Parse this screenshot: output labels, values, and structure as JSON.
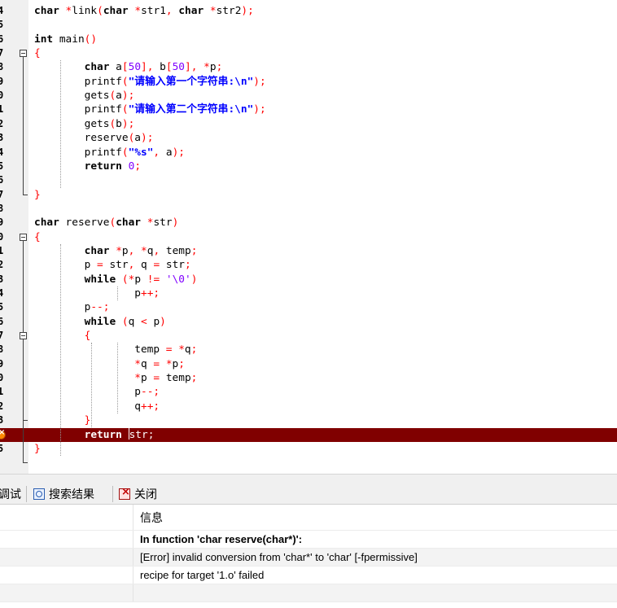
{
  "editor": {
    "lines": [
      {
        "num": "4",
        "tokens": [
          [
            "kw",
            "char"
          ],
          [
            "plain",
            " "
          ],
          [
            "sym",
            "*"
          ],
          [
            "plain",
            "link"
          ],
          [
            "sym",
            "("
          ],
          [
            "kw",
            "char"
          ],
          [
            "plain",
            " "
          ],
          [
            "sym",
            "*"
          ],
          [
            "plain",
            "str1"
          ],
          [
            "sym",
            ", "
          ],
          [
            "kw",
            "char"
          ],
          [
            "plain",
            " "
          ],
          [
            "sym",
            "*"
          ],
          [
            "plain",
            "str2"
          ],
          [
            "sym",
            ");"
          ]
        ]
      },
      {
        "num": "5",
        "tokens": []
      },
      {
        "num": "6",
        "tokens": [
          [
            "kw",
            "int"
          ],
          [
            "plain",
            " main"
          ],
          [
            "sym",
            "()"
          ]
        ]
      },
      {
        "num": "7",
        "tokens": [
          [
            "sym",
            "{"
          ]
        ]
      },
      {
        "num": "8",
        "tokens": [
          [
            "plain",
            "        "
          ],
          [
            "kw",
            "char"
          ],
          [
            "plain",
            " a"
          ],
          [
            "sym",
            "["
          ],
          [
            "num",
            "50"
          ],
          [
            "sym",
            "], "
          ],
          [
            "plain",
            "b"
          ],
          [
            "sym",
            "["
          ],
          [
            "num",
            "50"
          ],
          [
            "sym",
            "], *"
          ],
          [
            "plain",
            "p"
          ],
          [
            "sym",
            ";"
          ]
        ]
      },
      {
        "num": "9",
        "tokens": [
          [
            "plain",
            "        printf"
          ],
          [
            "sym",
            "("
          ],
          [
            "str",
            "\"请输入第一个字符串:\\n\""
          ],
          [
            "sym",
            ");"
          ]
        ]
      },
      {
        "num": "0",
        "tokens": [
          [
            "plain",
            "        gets"
          ],
          [
            "sym",
            "("
          ],
          [
            "plain",
            "a"
          ],
          [
            "sym",
            ");"
          ]
        ]
      },
      {
        "num": "1",
        "tokens": [
          [
            "plain",
            "        printf"
          ],
          [
            "sym",
            "("
          ],
          [
            "str",
            "\"请输入第二个字符串:\\n\""
          ],
          [
            "sym",
            ");"
          ]
        ]
      },
      {
        "num": "2",
        "tokens": [
          [
            "plain",
            "        gets"
          ],
          [
            "sym",
            "("
          ],
          [
            "plain",
            "b"
          ],
          [
            "sym",
            ");"
          ]
        ]
      },
      {
        "num": "3",
        "tokens": [
          [
            "plain",
            "        reserve"
          ],
          [
            "sym",
            "("
          ],
          [
            "plain",
            "a"
          ],
          [
            "sym",
            ");"
          ]
        ]
      },
      {
        "num": "4",
        "tokens": [
          [
            "plain",
            "        printf"
          ],
          [
            "sym",
            "("
          ],
          [
            "str",
            "\"%s\""
          ],
          [
            "sym",
            ", "
          ],
          [
            "plain",
            "a"
          ],
          [
            "sym",
            ");"
          ]
        ]
      },
      {
        "num": "5",
        "tokens": [
          [
            "plain",
            "        "
          ],
          [
            "kw",
            "return"
          ],
          [
            "plain",
            " "
          ],
          [
            "num",
            "0"
          ],
          [
            "sym",
            ";"
          ]
        ]
      },
      {
        "num": "6",
        "tokens": []
      },
      {
        "num": "7",
        "tokens": [
          [
            "sym",
            "}"
          ]
        ]
      },
      {
        "num": "8",
        "tokens": []
      },
      {
        "num": "9",
        "tokens": [
          [
            "kw",
            "char"
          ],
          [
            "plain",
            " reserve"
          ],
          [
            "sym",
            "("
          ],
          [
            "kw",
            "char"
          ],
          [
            "plain",
            " "
          ],
          [
            "sym",
            "*"
          ],
          [
            "plain",
            "str"
          ],
          [
            "sym",
            ")"
          ]
        ]
      },
      {
        "num": "0",
        "tokens": [
          [
            "sym",
            "{"
          ]
        ]
      },
      {
        "num": "1",
        "tokens": [
          [
            "plain",
            "        "
          ],
          [
            "kw",
            "char"
          ],
          [
            "plain",
            " "
          ],
          [
            "sym",
            "*"
          ],
          [
            "plain",
            "p"
          ],
          [
            "sym",
            ", *"
          ],
          [
            "plain",
            "q"
          ],
          [
            "sym",
            ", "
          ],
          [
            "plain",
            "temp"
          ],
          [
            "sym",
            ";"
          ]
        ]
      },
      {
        "num": "2",
        "tokens": [
          [
            "plain",
            "        p "
          ],
          [
            "sym",
            "="
          ],
          [
            "plain",
            " str"
          ],
          [
            "sym",
            ", "
          ],
          [
            "plain",
            "q "
          ],
          [
            "sym",
            "="
          ],
          [
            "plain",
            " str"
          ],
          [
            "sym",
            ";"
          ]
        ]
      },
      {
        "num": "3",
        "tokens": [
          [
            "plain",
            "        "
          ],
          [
            "kw",
            "while"
          ],
          [
            "plain",
            " "
          ],
          [
            "sym",
            "(*"
          ],
          [
            "plain",
            "p "
          ],
          [
            "sym",
            "!="
          ],
          [
            "plain",
            " "
          ],
          [
            "num",
            "'\\0'"
          ],
          [
            "sym",
            ")"
          ]
        ]
      },
      {
        "num": "4",
        "tokens": [
          [
            "plain",
            "                p"
          ],
          [
            "sym",
            "++;"
          ]
        ]
      },
      {
        "num": "5",
        "tokens": [
          [
            "plain",
            "        p"
          ],
          [
            "sym",
            "--;"
          ]
        ]
      },
      {
        "num": "6",
        "tokens": [
          [
            "plain",
            "        "
          ],
          [
            "kw",
            "while"
          ],
          [
            "plain",
            " "
          ],
          [
            "sym",
            "("
          ],
          [
            "plain",
            "q "
          ],
          [
            "sym",
            "<"
          ],
          [
            "plain",
            " p"
          ],
          [
            "sym",
            ")"
          ]
        ]
      },
      {
        "num": "7",
        "tokens": [
          [
            "plain",
            "        "
          ],
          [
            "sym",
            "{"
          ]
        ]
      },
      {
        "num": "8",
        "tokens": [
          [
            "plain",
            "                temp "
          ],
          [
            "sym",
            "= *"
          ],
          [
            "plain",
            "q"
          ],
          [
            "sym",
            ";"
          ]
        ]
      },
      {
        "num": "9",
        "tokens": [
          [
            "plain",
            "                "
          ],
          [
            "sym",
            "*"
          ],
          [
            "plain",
            "q "
          ],
          [
            "sym",
            "= *"
          ],
          [
            "plain",
            "p"
          ],
          [
            "sym",
            ";"
          ]
        ]
      },
      {
        "num": "0",
        "tokens": [
          [
            "plain",
            "                "
          ],
          [
            "sym",
            "*"
          ],
          [
            "plain",
            "p "
          ],
          [
            "sym",
            "="
          ],
          [
            "plain",
            " temp"
          ],
          [
            "sym",
            ";"
          ]
        ]
      },
      {
        "num": "1",
        "tokens": [
          [
            "plain",
            "                p"
          ],
          [
            "sym",
            "--;"
          ]
        ]
      },
      {
        "num": "2",
        "tokens": [
          [
            "plain",
            "                q"
          ],
          [
            "sym",
            "++;"
          ]
        ]
      },
      {
        "num": "3",
        "tokens": [
          [
            "plain",
            "        "
          ],
          [
            "sym",
            "}"
          ]
        ]
      },
      {
        "num": "",
        "tokens": [
          [
            "plain",
            "        "
          ],
          [
            "kw",
            "return"
          ],
          [
            "plain",
            " "
          ],
          [
            "caret",
            ""
          ],
          [
            "plain",
            "str"
          ],
          [
            "sym",
            ";"
          ]
        ]
      },
      {
        "num": "5",
        "tokens": [
          [
            "sym",
            "}"
          ]
        ]
      }
    ],
    "active_line_index": 30
  },
  "tabs": {
    "debug_label": "调试",
    "search_label": "搜索结果",
    "close_label": "关闭"
  },
  "messages": {
    "header": "信息",
    "rows": [
      {
        "text": "In function 'char reserve(char*)':",
        "bold": true
      },
      {
        "text": "[Error] invalid conversion from 'char*' to 'char' [-fpermissive]",
        "bold": false
      },
      {
        "text": "recipe for target '1.o' failed",
        "bold": false
      },
      {
        "text": "",
        "bold": false
      }
    ]
  },
  "colors": {
    "error_line_bg": "#800000",
    "keyword": "#000000",
    "symbol": "#ff0000",
    "string": "#0000ff",
    "number": "#8000ff"
  }
}
